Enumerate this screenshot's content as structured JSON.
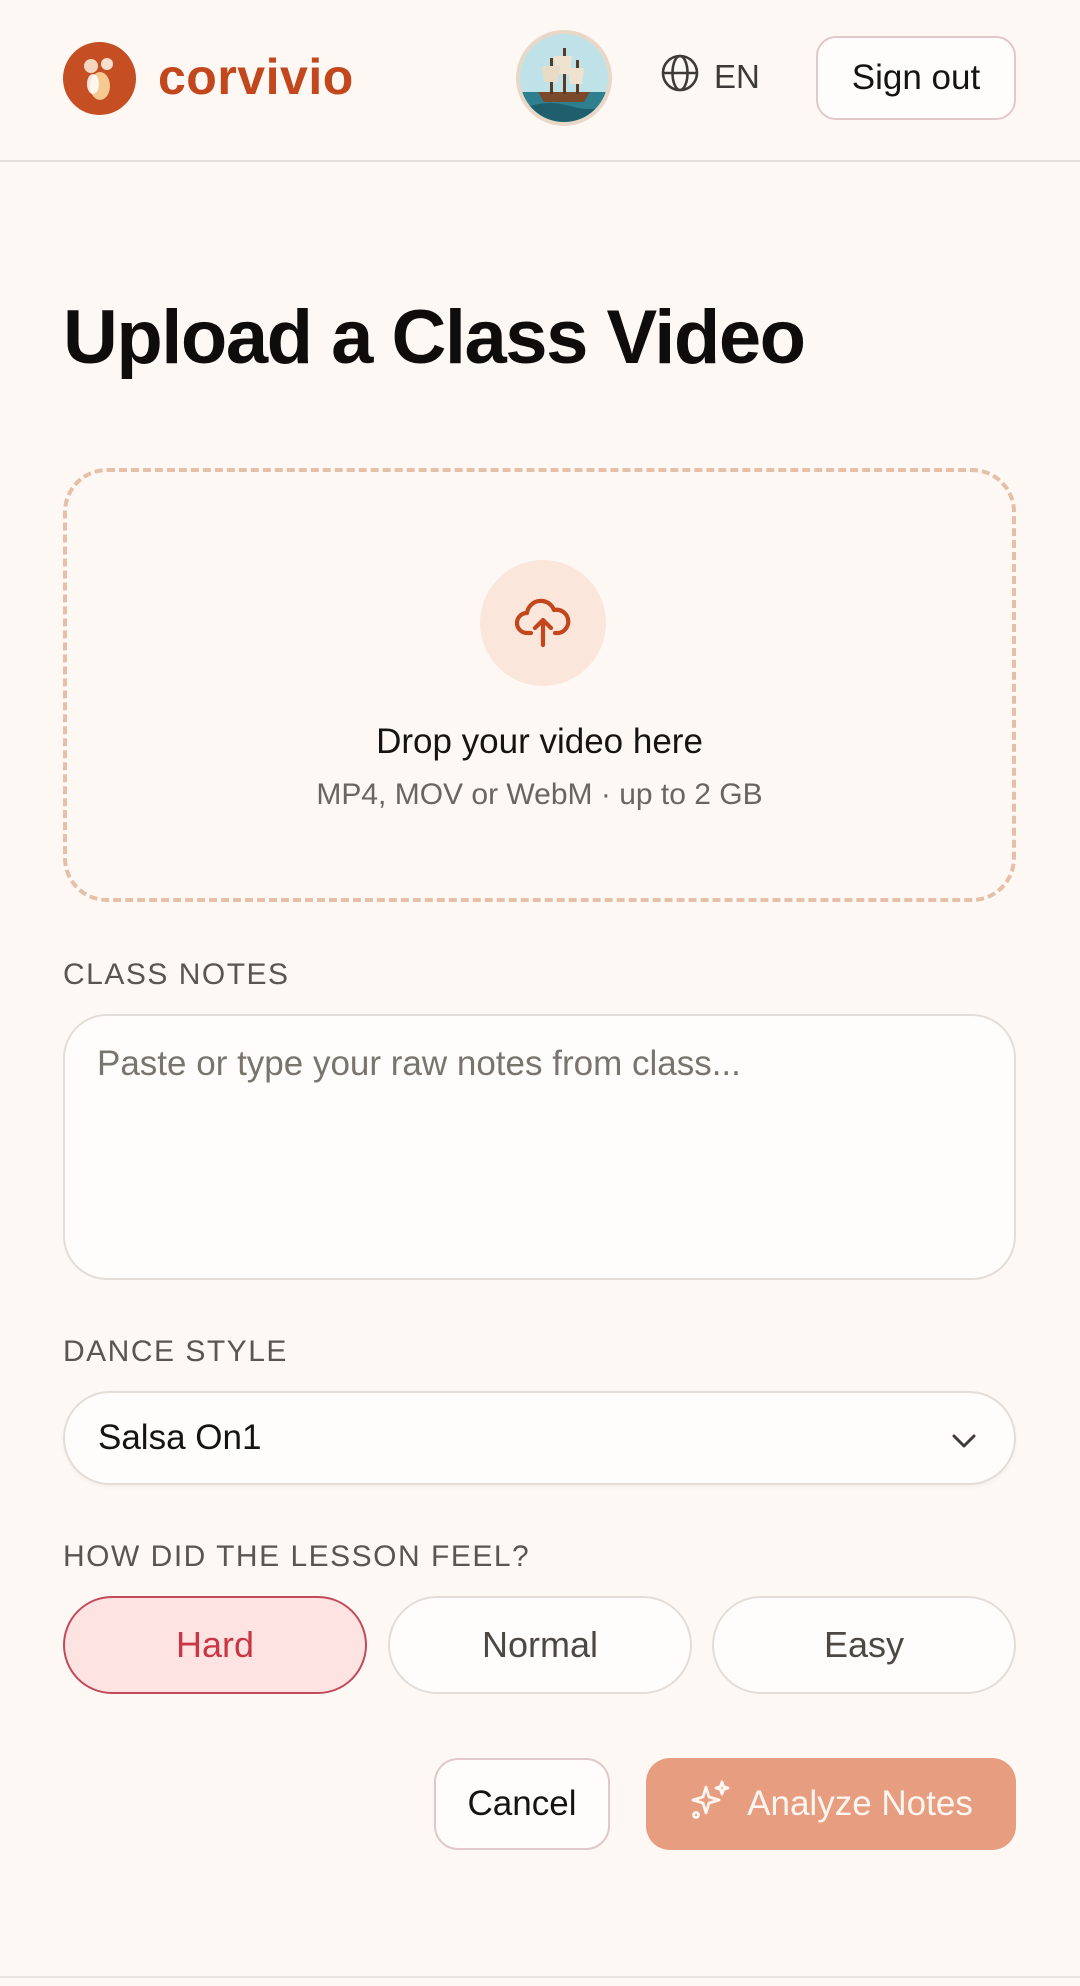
{
  "header": {
    "brand": "corvivio",
    "language": "EN",
    "sign_out_label": "Sign out"
  },
  "page": {
    "title": "Upload a Class Video"
  },
  "dropzone": {
    "title": "Drop your video here",
    "subtitle": "MP4, MOV or WebM · up to 2 GB",
    "icon": "cloud-upload-icon"
  },
  "notes": {
    "label": "CLASS NOTES",
    "placeholder": "Paste or type your raw notes from class...",
    "value": ""
  },
  "dance_style": {
    "label": "DANCE STYLE",
    "selected": "Salsa On1"
  },
  "lesson_feel": {
    "label": "HOW DID THE LESSON FEEL?",
    "options": [
      "Hard",
      "Normal",
      "Easy"
    ],
    "selected": "Hard"
  },
  "actions": {
    "cancel_label": "Cancel",
    "analyze_label": "Analyze Notes"
  },
  "colors": {
    "brand": "#c2471c",
    "background": "#fdf8f4",
    "accent_button": "#e79d7f",
    "selected_option": "#c93644"
  }
}
